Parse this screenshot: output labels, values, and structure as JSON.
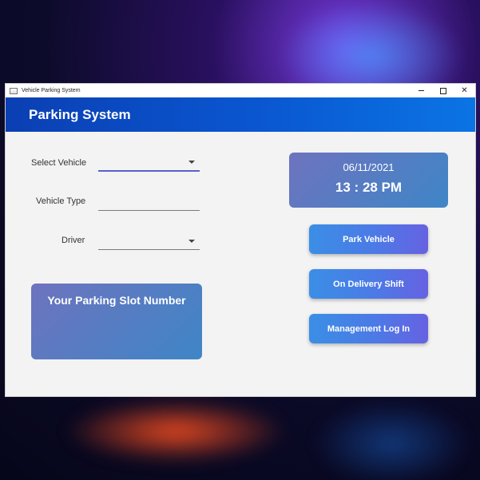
{
  "window": {
    "title": "Vehicle Parking System",
    "controls": {
      "minimize_icon": "minimize-icon",
      "maximize_icon": "maximize-icon",
      "close_label": "✕"
    }
  },
  "header": {
    "title": "Parking System"
  },
  "form": {
    "select_vehicle": {
      "label": "Select Vehicle",
      "value": ""
    },
    "vehicle_type": {
      "label": "Vehicle Type",
      "value": ""
    },
    "driver": {
      "label": "Driver",
      "value": ""
    }
  },
  "slot": {
    "title": "Your Parking Slot Number"
  },
  "clock": {
    "date": "06/11/2021",
    "time": "13 : 28 PM"
  },
  "actions": {
    "park_vehicle": "Park Vehicle",
    "on_delivery_shift": "On Delivery Shift",
    "management_login": "Management Log In"
  },
  "colors": {
    "header_gradient_start": "#0b3fb3",
    "header_gradient_end": "#0b74e5",
    "card_gradient_start": "#6e73be",
    "card_gradient_end": "#3e86c7",
    "button_gradient_start": "#3b8ee6",
    "button_gradient_end": "#6662e2",
    "active_underline": "#5b5fd0"
  }
}
